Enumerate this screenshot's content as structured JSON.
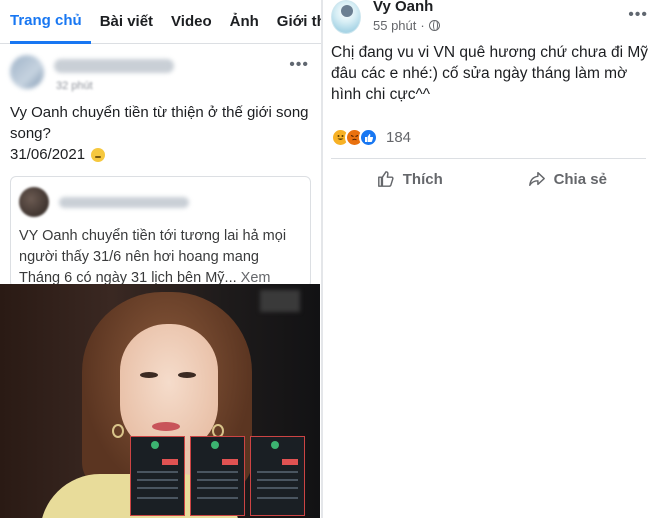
{
  "left": {
    "tabs": [
      {
        "label": "Trang chủ",
        "active": true
      },
      {
        "label": "Bài viết"
      },
      {
        "label": "Video"
      },
      {
        "label": "Ảnh"
      },
      {
        "label": "Giới thiệu"
      }
    ],
    "post": {
      "time": "32 phút",
      "text": "Vy Oanh chuyển tiền từ thiện ở thế giới song song?",
      "date": "31/06/2021",
      "shared": {
        "text": "VY Oanh chuyển tiền tới tương lai hả mọi người thấy 31/6 nên hơi hoang mang Tháng 6 có ngày 31 lịch bên Mỹ...",
        "see_more": "Xem thêm"
      }
    }
  },
  "right": {
    "name": "Vy Oanh",
    "time": "55 phút",
    "text": "Chị đang vu vi VN quê hương chứ chưa đi Mỹ đâu các e nhé:) cố sửa ngày tháng làm mờ hình chi cực^^",
    "reactions": {
      "count": "184"
    },
    "actions": {
      "like": "Thích",
      "share": "Chia sẻ"
    }
  },
  "colors": {
    "accent": "#1877f2",
    "text": "#1c1e21",
    "secondary": "#65676b"
  }
}
